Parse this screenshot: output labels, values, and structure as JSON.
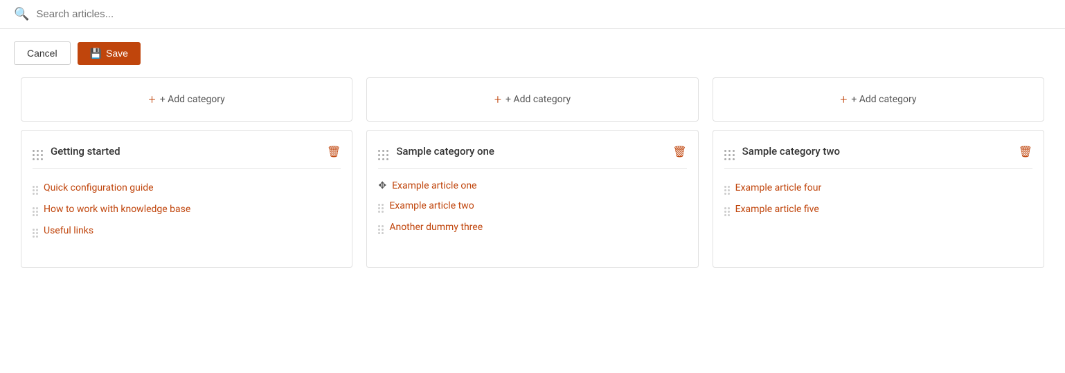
{
  "search": {
    "placeholder": "Search articles..."
  },
  "toolbar": {
    "cancel_label": "Cancel",
    "save_label": "Save"
  },
  "columns": [
    {
      "id": "col1",
      "add_category_label": "+ Add category",
      "category": {
        "title": "Getting started",
        "articles": [
          {
            "label": "Quick configuration guide"
          },
          {
            "label": "How to work with knowledge base"
          },
          {
            "label": "Useful links"
          }
        ]
      }
    },
    {
      "id": "col2",
      "add_category_label": "+ Add category",
      "category": {
        "title": "Sample category one",
        "articles": [
          {
            "label": "Example article one",
            "dragging": true
          },
          {
            "label": "Example article two"
          },
          {
            "label": "Another dummy three"
          }
        ]
      }
    },
    {
      "id": "col3",
      "add_category_label": "+ Add category",
      "category": {
        "title": "Sample category two",
        "articles": [
          {
            "label": "Example article four"
          },
          {
            "label": "Example article five"
          }
        ]
      }
    }
  ]
}
